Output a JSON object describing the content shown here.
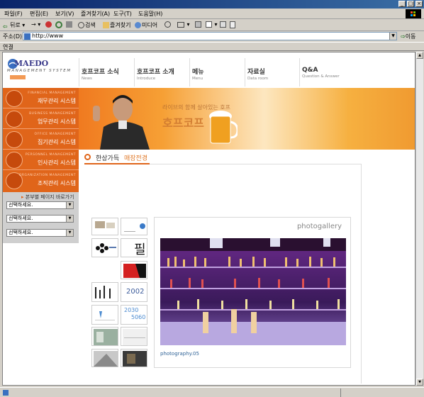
{
  "browser": {
    "menu": [
      "파일(F)",
      "편집(E)",
      "보기(V)",
      "즐겨찾기(A)",
      "도구(T)",
      "도움말(H)"
    ],
    "toolbar": {
      "back": "뒤로",
      "search": "검색",
      "favorites": "즐겨찾기",
      "media": "미디어"
    },
    "address_label": "주소(D)",
    "address_value": "http://www",
    "go_label": "이동",
    "links_label": "연결"
  },
  "site": {
    "logo_text": "MAEDO",
    "logo_sub": "MANAGEMENT SYSTEM",
    "nav": [
      {
        "title": "호프코프 소식",
        "sub": "News"
      },
      {
        "title": "호프코프 소개",
        "sub": "Introduce"
      },
      {
        "title": "메뉴",
        "sub": "Menu"
      },
      {
        "title": "자료실",
        "sub": "Data room"
      },
      {
        "title": "Q&A",
        "sub": "Question & Answer"
      }
    ],
    "sidemenu": [
      {
        "eng": "FINANCIAL MANAGEMENT",
        "kor": "재무관리 시스템"
      },
      {
        "eng": "BUSINESS MANAGEMENT",
        "kor": "업무관리 시스템"
      },
      {
        "eng": "OFFICE MANAGEMENT",
        "kor": "집기관리 시스템"
      },
      {
        "eng": "PERSONNEL MANAGEMENT",
        "kor": "인사관리 시스템"
      },
      {
        "eng": "ORGANIZATION MANAGEMENT",
        "kor": "조직관리 시스템"
      }
    ],
    "branch_shortcut": "본부별 페이지 바로가기",
    "selects": [
      "선택하세요.",
      "선택하세요.",
      "선택하세요."
    ],
    "banner_text1": "라이브의 함께 살아있는 호프",
    "banner_text2": "호프코프",
    "section_title_main": "한상가득",
    "section_title_sub": "매장전경",
    "gallery_title": "photogallery",
    "photo_caption": "photography.05",
    "thumb_texts": [
      "2002",
      "2030",
      "5060"
    ]
  },
  "colors": {
    "orange": "#e0651a",
    "gallery_title": "#888888",
    "caption": "#336699"
  }
}
